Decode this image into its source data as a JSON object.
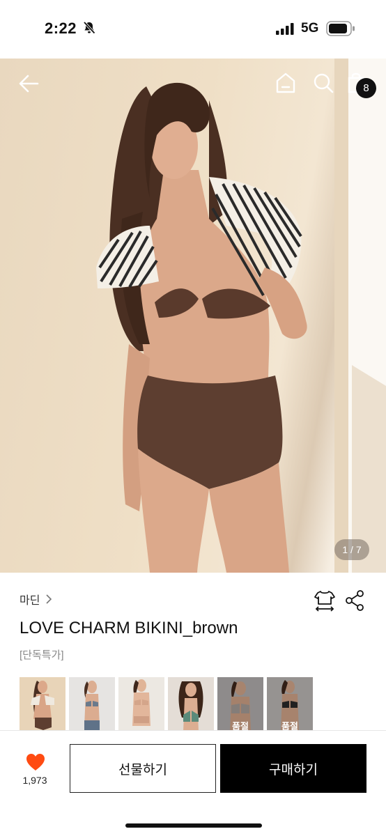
{
  "status_bar": {
    "time": "2:22",
    "network": "5G",
    "icons": [
      "bell-slash-icon",
      "signal-bars-icon",
      "battery-icon"
    ]
  },
  "nav": {
    "icons": [
      "arrow-left-icon",
      "home-icon",
      "search-icon",
      "shopping-bag-icon"
    ],
    "cart_count": "8"
  },
  "gallery": {
    "indicator": "1 / 7"
  },
  "product": {
    "brand": "마딘",
    "brand_chevron": "›",
    "title": "LOVE CHARM BIKINI_brown",
    "tag": "[단독특가]",
    "action_icons": [
      "size-guide-icon",
      "share-icon"
    ]
  },
  "thumbnails": [
    {
      "label": "",
      "selected": true
    },
    {
      "label": "",
      "selected": false
    },
    {
      "label": "",
      "selected": false
    },
    {
      "label": "",
      "selected": false
    },
    {
      "label": "품절",
      "selected": false
    },
    {
      "label": "품절",
      "selected": false
    }
  ],
  "bottom_bar": {
    "like_count": "1,973",
    "gift_label": "선물하기",
    "buy_label": "구매하기",
    "accent_color": "#ff4b12"
  }
}
